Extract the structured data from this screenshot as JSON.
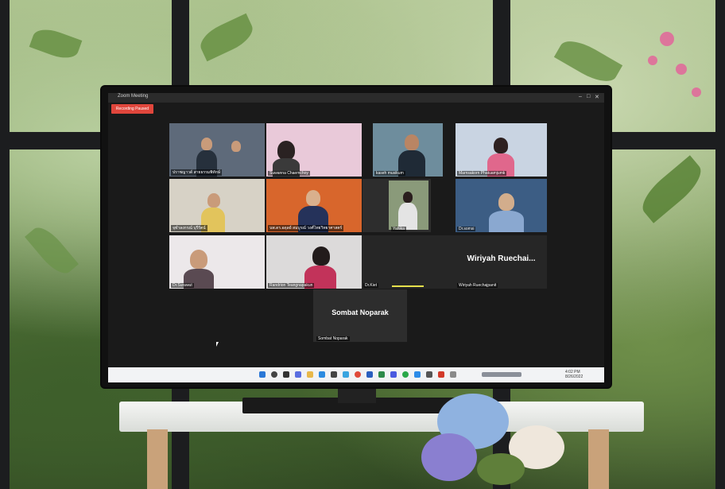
{
  "window": {
    "title": "Zoom Meeting",
    "minimize": "–",
    "maximize": "□",
    "close": "✕"
  },
  "recording_label": "Recording Paused",
  "participants": [
    {
      "name": "ปราชญาวด์ สายธรรมพิทักษ์"
    },
    {
      "name": "Suwanna Chaemchoy"
    },
    {
      "name": "kaseh musikum"
    },
    {
      "name": "Marnsakorn Phatuamjumk"
    },
    {
      "name": "จุฬาลงกรณ์ บุรีรัตน์"
    },
    {
      "name": "นพ.ดร.อดุลย์ สมบูรณ์ วงศ์ไทยวิทยาศาสตร์"
    },
    {
      "name": "Yahika"
    },
    {
      "name": "Dr.somsi"
    },
    {
      "name": "Dr.Surawut"
    },
    {
      "name": "Randrion Teangnapakun"
    },
    {
      "name": "Dr.Kiet"
    },
    {
      "name": "Wiriyah Ruechajpanit",
      "display": "Wiriyah Ruechai..."
    }
  ],
  "active_speaker": {
    "display": "Sombat Noparak",
    "label": "Sombat Noparak"
  },
  "taskbar": {
    "time": "4:02 PM",
    "date": "8/26/2022"
  },
  "colors": {
    "recording": "#e0463c",
    "zoom_bg": "#1a1a1a",
    "taskbar": "#f2f3f5"
  }
}
